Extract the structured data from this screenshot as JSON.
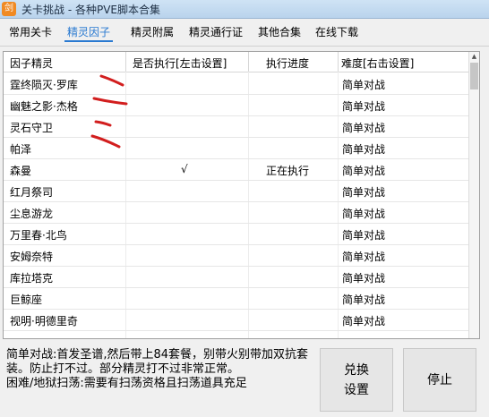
{
  "window": {
    "title": "关卡挑战 - 各种PVE脚本合集",
    "icon_text": "剑"
  },
  "tabs": [
    {
      "label": "常用关卡"
    },
    {
      "label": "精灵因子"
    },
    {
      "label": "精灵附属"
    },
    {
      "label": "精灵通行证"
    },
    {
      "label": "其他合集"
    },
    {
      "label": "在线下载"
    }
  ],
  "active_tab": "精灵因子",
  "accent_color": "#2a7ad1",
  "annotation_color": "#d21e1e",
  "table": {
    "headers": [
      "因子精灵",
      "是否执行[左击设置]",
      "执行进度",
      "难度[右击设置]"
    ],
    "rows": [
      {
        "name": "霆终陨灭·罗库",
        "exec": "",
        "progress": "",
        "difficulty": "简单对战"
      },
      {
        "name": "幽魅之影·杰格",
        "exec": "",
        "progress": "",
        "difficulty": "简单对战"
      },
      {
        "name": "灵石守卫",
        "exec": "",
        "progress": "",
        "difficulty": "简单对战"
      },
      {
        "name": "帕泽",
        "exec": "",
        "progress": "",
        "difficulty": "简单对战"
      },
      {
        "name": "森曼",
        "exec": "√",
        "progress": "正在执行",
        "difficulty": "简单对战"
      },
      {
        "name": "红月祭司",
        "exec": "",
        "progress": "",
        "difficulty": "简单对战"
      },
      {
        "name": "尘息游龙",
        "exec": "",
        "progress": "",
        "difficulty": "简单对战"
      },
      {
        "name": "万里春·北鸟",
        "exec": "",
        "progress": "",
        "difficulty": "简单对战"
      },
      {
        "name": "安姆奈特",
        "exec": "",
        "progress": "",
        "difficulty": "简单对战"
      },
      {
        "name": "库拉塔克",
        "exec": "",
        "progress": "",
        "difficulty": "简单对战"
      },
      {
        "name": "巨鲸座",
        "exec": "",
        "progress": "",
        "difficulty": "简单对战"
      },
      {
        "name": "视明·明德里奇",
        "exec": "",
        "progress": "",
        "difficulty": "简单对战"
      }
    ]
  },
  "description": {
    "line1": "简单对战:首发圣谱,然后带上84套餐，别带火别带加双抗套装。防止打不过。部分精灵打不过非常正常。",
    "line2": "困难/地狱扫荡:需要有扫荡资格且扫荡道具充足"
  },
  "buttons": {
    "exchange_line1": "兑换",
    "exchange_line2": "设置",
    "stop": "停止"
  }
}
